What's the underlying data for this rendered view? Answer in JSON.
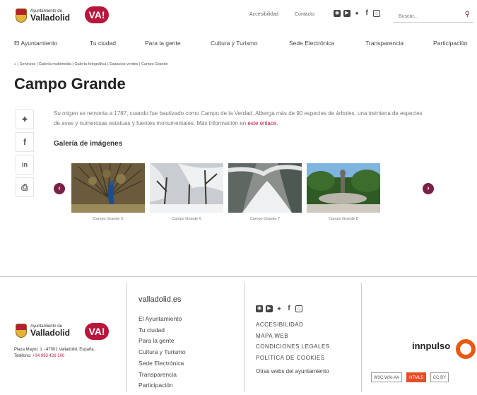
{
  "header": {
    "logo_small": "Ayuntamiento de",
    "logo_big": "Valladolid",
    "va_label": "VA!",
    "links": [
      "Accesibilidad",
      "Contacto"
    ],
    "social_icons": [
      "rss-icon",
      "youtube-icon",
      "twitter-icon",
      "facebook-icon",
      "instagram-icon"
    ],
    "search_placeholder": "Buscar..."
  },
  "nav": [
    "El Ayuntamiento",
    "Tu ciudad",
    "Para la gente",
    "Cultura y Turismo",
    "Sede Electrónica",
    "Transparencia",
    "Participación"
  ],
  "breadcrumb": [
    "Servicios",
    "Galería multimedia",
    "Galería fotográfica",
    "Espacios verdes",
    "Campo Grande"
  ],
  "page": {
    "title": "Campo Grande",
    "description_pre": "Su origen se remonta a 1787, cuando fue bautizado como Campo de la Verdad. Alberga más de 90 especies de árboles, una treintena de especies de aves y numerosas estatuas y fuentes monumentales. Más información en ",
    "description_link": "este enlace",
    "description_post": ".",
    "gallery_title": "Galería de imágenes"
  },
  "share_icons": [
    "twitter-icon",
    "facebook-icon",
    "linkedin-icon",
    "print-icon"
  ],
  "gallery": [
    {
      "caption": "Campo Grande 3"
    },
    {
      "caption": "Campo Grande 6"
    },
    {
      "caption": "Campo Grande 7"
    },
    {
      "caption": "Campo Grande 8"
    }
  ],
  "footer": {
    "address": "Plaza Mayor, 1 - 47001 Valladolid, España.",
    "tel_label": "Teléfono:",
    "tel": "+34 983 426 100",
    "site": "valladolid.es",
    "links": [
      "El Ayuntamiento",
      "Tu ciudad",
      "Para la gente",
      "Cultura y Turismo",
      "Sede Electrónica",
      "Transparencia",
      "Participación"
    ],
    "legal": [
      "ACCESIBILIDAD",
      "MAPA WEB",
      "CONDICIONES LEGALES",
      "POLÍTICA DE COOKIES"
    ],
    "other": "Otras webs del ayuntamiento",
    "innpulso": "innpulso",
    "badges": [
      "W3C WAI-AA",
      "HTML5",
      "CC BY"
    ]
  },
  "colors": {
    "accent": "#7a1f45",
    "brand_red": "#b8163a",
    "innpulso_orange": "#e85a12"
  }
}
